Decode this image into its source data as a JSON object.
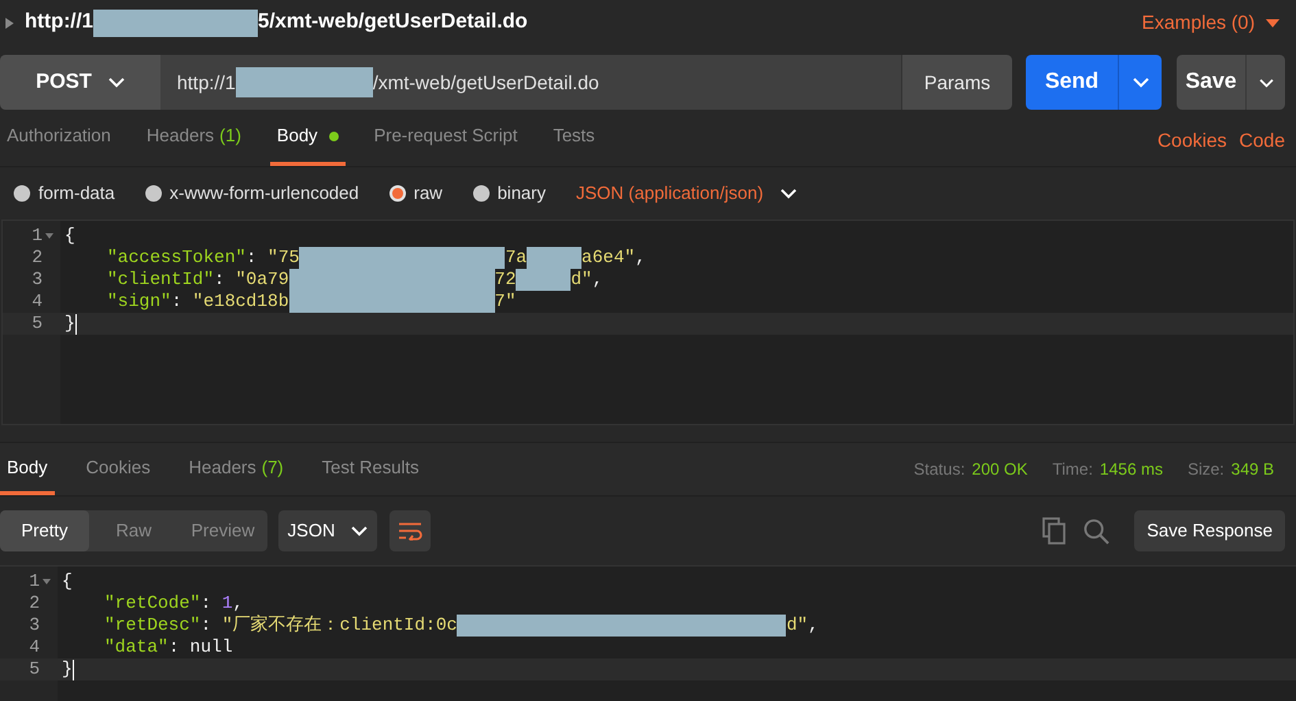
{
  "request_title": {
    "segments": [
      {
        "kind": "text",
        "text": "http://1"
      },
      {
        "kind": "redacted"
      },
      {
        "kind": "text",
        "text": "5/xmt-web/getUserDetail.do"
      }
    ]
  },
  "examples_link": "Examples (0)",
  "method": "POST",
  "url_field": {
    "segments": [
      {
        "kind": "text",
        "text": "http://1"
      },
      {
        "kind": "redacted"
      },
      {
        "kind": "text",
        "text": "/xmt-web/getUserDetail.do"
      }
    ]
  },
  "params_button": "Params",
  "send_button": "Send",
  "save_button": "Save",
  "request_tabs": [
    {
      "label": "Authorization",
      "selected": false,
      "modified": false
    },
    {
      "label": "Headers",
      "count": "(1)",
      "selected": false,
      "modified": false
    },
    {
      "label": "Body",
      "selected": true,
      "modified": true
    },
    {
      "label": "Pre-request Script",
      "selected": false,
      "modified": false
    },
    {
      "label": "Tests",
      "selected": false,
      "modified": false
    }
  ],
  "request_links": [
    "Cookies",
    "Code"
  ],
  "body_modes": [
    {
      "label": "form-data",
      "selected": false
    },
    {
      "label": "x-www-form-urlencoded",
      "selected": false
    },
    {
      "label": "raw",
      "selected": true
    },
    {
      "label": "binary",
      "selected": false
    }
  ],
  "content_type": "JSON (application/json)",
  "request_body": {
    "lines": [
      {
        "number": "1",
        "foldable": true,
        "active": false,
        "indented": false,
        "tokens": [
          {
            "kind": "punct",
            "text": "{"
          }
        ]
      },
      {
        "number": "2",
        "foldable": false,
        "active": false,
        "indented": true,
        "tokens": [
          {
            "kind": "key",
            "text": "\"accessToken\""
          },
          {
            "kind": "punct",
            "text": ": "
          },
          {
            "kind": "string",
            "text": "\"75"
          },
          {
            "kind": "redacted"
          },
          {
            "kind": "string",
            "text": "7a"
          },
          {
            "kind": "redacted"
          },
          {
            "kind": "string",
            "text": "a6e4\""
          },
          {
            "kind": "punct",
            "text": ","
          }
        ]
      },
      {
        "number": "3",
        "foldable": false,
        "active": false,
        "indented": true,
        "tokens": [
          {
            "kind": "key",
            "text": "\"clientId\""
          },
          {
            "kind": "punct",
            "text": ": "
          },
          {
            "kind": "string",
            "text": "\"0a79"
          },
          {
            "kind": "redacted"
          },
          {
            "kind": "string",
            "text": "72"
          },
          {
            "kind": "redacted"
          },
          {
            "kind": "string",
            "text": "d\""
          },
          {
            "kind": "punct",
            "text": ","
          }
        ]
      },
      {
        "number": "4",
        "foldable": false,
        "active": false,
        "indented": true,
        "tokens": [
          {
            "kind": "key",
            "text": "\"sign\""
          },
          {
            "kind": "punct",
            "text": ": "
          },
          {
            "kind": "string",
            "text": "\"e18cd18b"
          },
          {
            "kind": "redacted"
          },
          {
            "kind": "string",
            "text": "7\""
          }
        ]
      },
      {
        "number": "5",
        "foldable": false,
        "active": true,
        "indented": false,
        "tokens": [
          {
            "kind": "punct",
            "text": "}"
          }
        ]
      }
    ]
  },
  "response_tabs": [
    {
      "label": "Body",
      "selected": true
    },
    {
      "label": "Cookies",
      "selected": false
    },
    {
      "label": "Headers",
      "count": "(7)",
      "selected": false
    },
    {
      "label": "Test Results",
      "selected": false
    }
  ],
  "response_status": [
    {
      "label": "Status:",
      "value": "200 OK"
    },
    {
      "label": "Time:",
      "value": "1456 ms"
    },
    {
      "label": "Size:",
      "value": "349 B"
    }
  ],
  "view_modes": [
    {
      "label": "Pretty",
      "selected": true
    },
    {
      "label": "Raw",
      "selected": false
    },
    {
      "label": "Preview",
      "selected": false
    }
  ],
  "format": "JSON",
  "save_response_button": "Save Response",
  "response_body": {
    "lines": [
      {
        "number": "1",
        "foldable": true,
        "active": false,
        "indented": false,
        "tokens": [
          {
            "kind": "punct",
            "text": "{"
          }
        ]
      },
      {
        "number": "2",
        "foldable": false,
        "active": false,
        "indented": true,
        "tokens": [
          {
            "kind": "key",
            "text": "\"retCode\""
          },
          {
            "kind": "punct",
            "text": ": "
          },
          {
            "kind": "number",
            "text": "1"
          },
          {
            "kind": "punct",
            "text": ","
          }
        ]
      },
      {
        "number": "3",
        "foldable": false,
        "active": false,
        "indented": true,
        "tokens": [
          {
            "kind": "key",
            "text": "\"retDesc\""
          },
          {
            "kind": "punct",
            "text": ": "
          },
          {
            "kind": "string",
            "text": "\"厂家不存在：clientId:0c"
          },
          {
            "kind": "redacted"
          },
          {
            "kind": "string",
            "text": "d\""
          },
          {
            "kind": "punct",
            "text": ","
          }
        ]
      },
      {
        "number": "4",
        "foldable": false,
        "active": false,
        "indented": true,
        "tokens": [
          {
            "kind": "key",
            "text": "\"data\""
          },
          {
            "kind": "punct",
            "text": ": "
          },
          {
            "kind": "null",
            "text": "null"
          }
        ]
      },
      {
        "number": "5",
        "foldable": false,
        "active": true,
        "indented": false,
        "tokens": [
          {
            "kind": "punct",
            "text": "}"
          }
        ]
      }
    ]
  }
}
